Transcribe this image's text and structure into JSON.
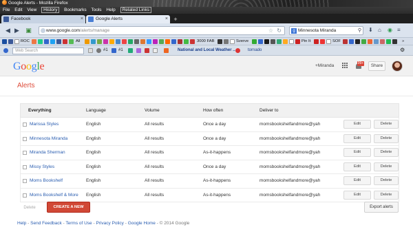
{
  "window": {
    "title": "Google Alerts - Mozilla Firefox"
  },
  "menubar": [
    "File",
    "Edit",
    "View",
    "History",
    "Bookmarks",
    "Tools",
    "Help",
    "Related Links"
  ],
  "tabs": [
    {
      "label": "Facebook",
      "active": false,
      "icon_color": "#3b5998"
    },
    {
      "label": "Google Alerts",
      "active": true,
      "icon_color": "#4a7fd4"
    }
  ],
  "navbar": {
    "url_domain": "www.google.com",
    "url_path": "/alerts/manage",
    "search_value": "Minnesota Miranda"
  },
  "bookmarks": [
    {
      "label": "ROC",
      "color": "#555"
    },
    {
      "label": "All",
      "color": "#3a7"
    },
    {
      "label": "3000 FAB",
      "color": "#c33"
    },
    {
      "label": "Sverve",
      "color": "#777"
    },
    {
      "label": "Pin It",
      "color": "#c22"
    },
    {
      "label": "SOF",
      "color": "#fc0"
    }
  ],
  "addonbar": {
    "websearch_placeholder": "Web Search",
    "weather_label": "National and Local Weather ...",
    "tornado_label": "tornado"
  },
  "google": {
    "logo": "Google",
    "plus_name": "+Miranda",
    "notif_count": "99+",
    "share_label": "Share"
  },
  "page": {
    "title": "Alerts",
    "columns": {
      "everything": "Everything",
      "language": "Language",
      "volume": "Volume",
      "how_often": "How often",
      "deliver_to": "Deliver to"
    },
    "rows": [
      {
        "name": "Marissa Styles",
        "language": "English",
        "volume": "All results",
        "how_often": "Once a day",
        "deliver_to": "momsbookshelfandmore@yah",
        "edit": "Edit",
        "delete": "Delete"
      },
      {
        "name": "Minnesota Miranda",
        "language": "English",
        "volume": "All results",
        "how_often": "Once a day",
        "deliver_to": "momsbookshelfandmore@yah",
        "edit": "Edit",
        "delete": "Delete"
      },
      {
        "name": "Miranda Sherman",
        "language": "English",
        "volume": "All results",
        "how_often": "As-it-happens",
        "deliver_to": "momsbookshelfandmore@yah",
        "edit": "Edit",
        "delete": "Delete"
      },
      {
        "name": "Missy Styles",
        "language": "English",
        "volume": "All results",
        "how_often": "Once a day",
        "deliver_to": "momsbookshelfandmore@yah",
        "edit": "Edit",
        "delete": "Delete"
      },
      {
        "name": "Moms Bookshelf",
        "language": "English",
        "volume": "All results",
        "how_often": "As-it-happens",
        "deliver_to": "momsbookshelfandmore@yah",
        "edit": "Edit",
        "delete": "Delete"
      },
      {
        "name": "Moms Bookshelf & More",
        "language": "English",
        "volume": "All results",
        "how_often": "As-it-happens",
        "deliver_to": "momsbookshelfandmore@yah",
        "edit": "Edit",
        "delete": "Delete"
      }
    ],
    "delete_label": "Delete",
    "create_label": "CREATE A NEW ALERT",
    "export_label": "Export alerts"
  },
  "footer": {
    "help": "Help",
    "sep": " - ",
    "send_feedback": "Send Feedback",
    "terms": "Terms of Use",
    "privacy": "Privacy Policy",
    "google_home": "Google Home",
    "copyright": "© 2014 Google"
  },
  "colors": {
    "accent_red": "#dd4b39",
    "link_blue": "#2a5db0",
    "create_button": "#d14836"
  }
}
